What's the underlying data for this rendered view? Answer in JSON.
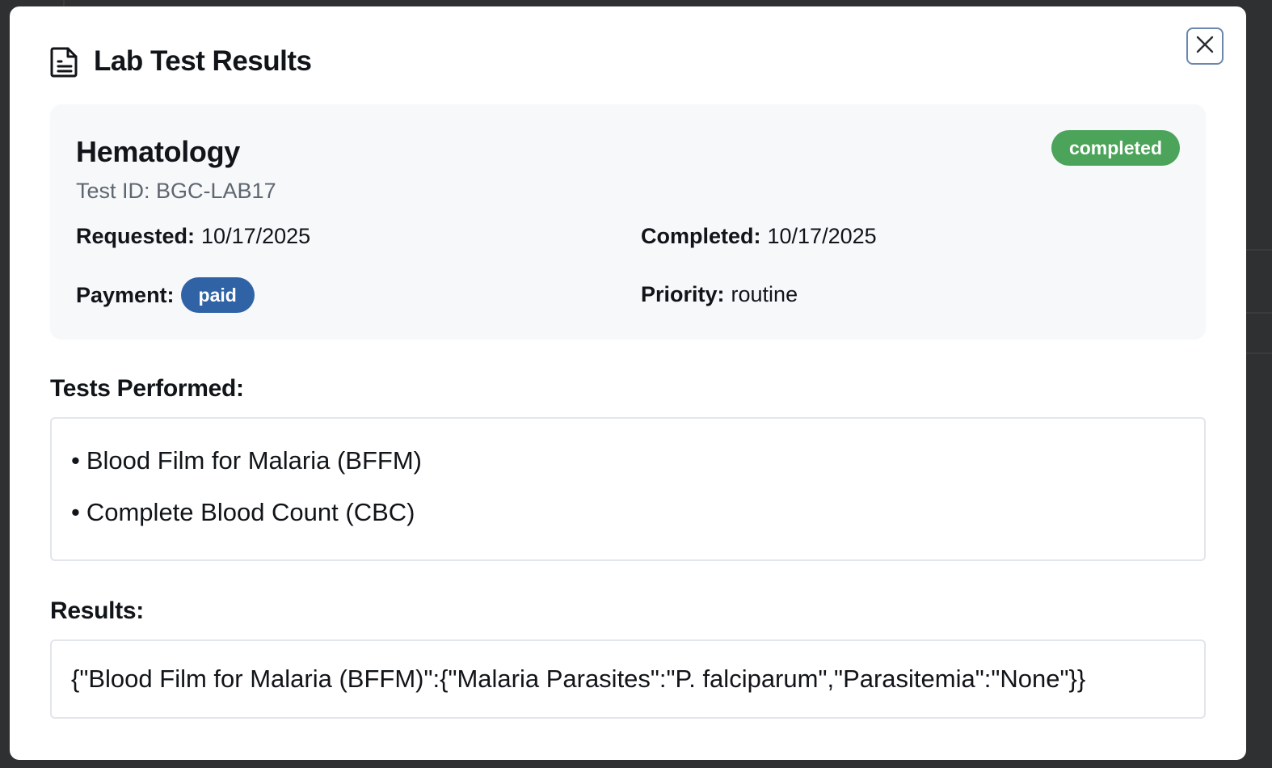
{
  "modal": {
    "title": "Lab Test Results",
    "close_icon": "close-icon",
    "title_icon": "document-icon"
  },
  "test": {
    "department": "Hematology",
    "test_id": "Test ID: BGC-LAB17",
    "status": "completed",
    "status_color": "#4ca35a",
    "requested_label": "Requested:",
    "requested_value": "10/17/2025",
    "completed_label": "Completed:",
    "completed_value": "10/17/2025",
    "payment_label": "Payment:",
    "payment_value": "paid",
    "payment_color": "#2f63a6",
    "priority_label": "Priority:",
    "priority_value": "routine"
  },
  "tests_performed": {
    "heading": "Tests Performed:",
    "bullet": "•",
    "items": [
      "Blood Film for Malaria (BFFM)",
      "Complete Blood Count (CBC)"
    ]
  },
  "results": {
    "heading": "Results:",
    "text": "{\"Blood Film for Malaria (BFFM)\":{\"Malaria Parasites\":\"P. falciparum\",\"Parasitemia\":\"None\"}}"
  }
}
